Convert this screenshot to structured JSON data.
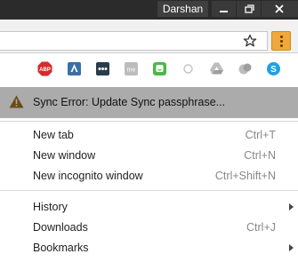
{
  "window": {
    "user_name": "Darshan"
  },
  "extensions": [
    {
      "icon": "adblock-plus-icon"
    },
    {
      "icon": "ext-blue-a-icon"
    },
    {
      "icon": "ext-dots-icon"
    },
    {
      "icon": "ext-me-icon"
    },
    {
      "icon": "ext-green-smile-icon"
    },
    {
      "icon": "ext-circle-icon"
    },
    {
      "icon": "google-drive-icon"
    },
    {
      "icon": "ext-grey-icon"
    },
    {
      "icon": "skype-icon"
    }
  ],
  "menu": {
    "sync_error": "Sync Error: Update Sync passphrase...",
    "new_tab": {
      "label": "New tab",
      "shortcut": "Ctrl+T"
    },
    "new_window": {
      "label": "New window",
      "shortcut": "Ctrl+N"
    },
    "new_incognito": {
      "label": "New incognito window",
      "shortcut": "Ctrl+Shift+N"
    },
    "history": {
      "label": "History"
    },
    "downloads": {
      "label": "Downloads",
      "shortcut": "Ctrl+J"
    },
    "bookmarks": {
      "label": "Bookmarks"
    }
  },
  "colors": {
    "titlebar": "#2b2b2b",
    "menu_button": "#f0a83a",
    "sync_row": "#ababab",
    "warning": "#6b4a14"
  }
}
